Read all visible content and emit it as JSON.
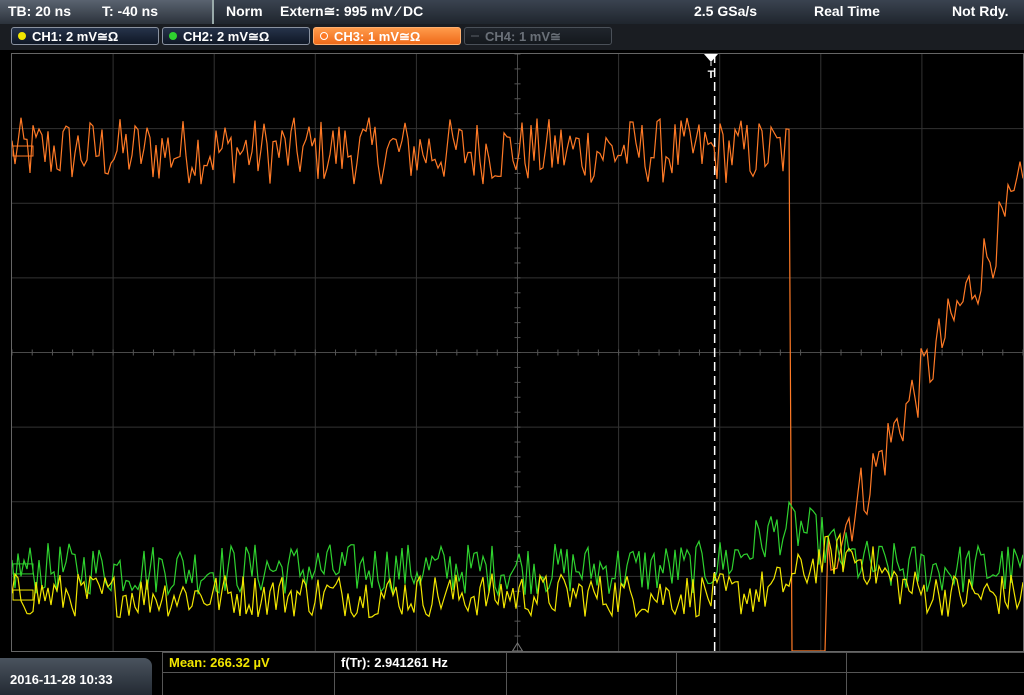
{
  "header": {
    "timebase": "TB: 20 ns",
    "trigger_time": "T: -40 ns",
    "acq_mode": "Norm",
    "trigger_source": "Extern≅: 995 mV ⁄ DC",
    "sample_rate": "2.5 GSa/s",
    "time_mode": "Real Time",
    "status": "Not Rdy."
  },
  "channels": [
    {
      "label": "CH1: 2 mV≅Ω",
      "color": "#f2e600",
      "state": "on"
    },
    {
      "label": "CH2: 2 mV≅Ω",
      "color": "#2fd22f",
      "state": "on"
    },
    {
      "label": "CH3: 1 mV≅Ω",
      "color": "#ff7a26",
      "state": "selected"
    },
    {
      "label": "CH4: 1 mV≅",
      "color": "#5b6068",
      "state": "off"
    }
  ],
  "trigger_marker": "T",
  "footer": {
    "datetime": "2016-11-28 10:33",
    "mean": "Mean: 266.32 µV",
    "freq": "f(Tr): 2.941261 Hz"
  },
  "chart_data": {
    "type": "line",
    "title": "",
    "grid": true,
    "x_divisions": 10,
    "y_divisions": 8,
    "trigger_position_div": 6.95,
    "series": [
      {
        "name": "CH3",
        "color": "#ff7a26",
        "level_div": 6.7,
        "noise_div": 0.45,
        "step_at_div": 7.7,
        "drop_to_div": -0.5,
        "recovery_end_div": 6.2
      },
      {
        "name": "CH2",
        "color": "#2fd22f",
        "level_div": 1.1,
        "noise_div": 0.35,
        "bump_at_div": 7.7
      },
      {
        "name": "CH1",
        "color": "#f2e600",
        "level_div": 0.75,
        "noise_div": 0.3,
        "bump_at_div": 8.2
      }
    ]
  }
}
